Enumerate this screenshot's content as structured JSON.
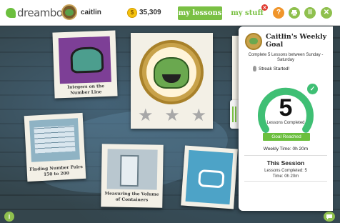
{
  "header": {
    "logo_prefix": "d",
    "logo_text": "dreambox",
    "username": "caitlin",
    "coins": "35,309",
    "tab_lessons": "my lessons",
    "tab_stuff": "my stuff",
    "stuff_badge": "",
    "help_icon": "?",
    "pause_icon": "II",
    "close_icon": "✕"
  },
  "lessons": [
    {
      "label": "Integers on the Number Line"
    },
    {
      "label": ""
    },
    {
      "label": "Finding Number Pairs 150 to 200"
    },
    {
      "label": "Measuring the Volume of Containers"
    },
    {
      "label": ""
    }
  ],
  "main_lesson": {
    "stars_total": 3,
    "stars_earned": 0
  },
  "goal_panel": {
    "title": "Caitlin's Weekly Goal",
    "subtitle": "Complete 5 Lessons between Sunday - Saturday",
    "streak": "Streak Started!",
    "lessons_completed_count": "5",
    "lessons_completed_label": "Lessons Completed",
    "goal_progress": 1.0,
    "goal_status": "Goal Reached",
    "weekly_time": "Weekly Time: 0h 20m",
    "session_title": "This Session",
    "session_lessons": "Lessons Completed: 5",
    "session_time": "Time: 0h 20m"
  },
  "colors": {
    "accent_green": "#7ac043",
    "gauge_teal": "#3fbf74",
    "help_orange": "#f0952b"
  }
}
